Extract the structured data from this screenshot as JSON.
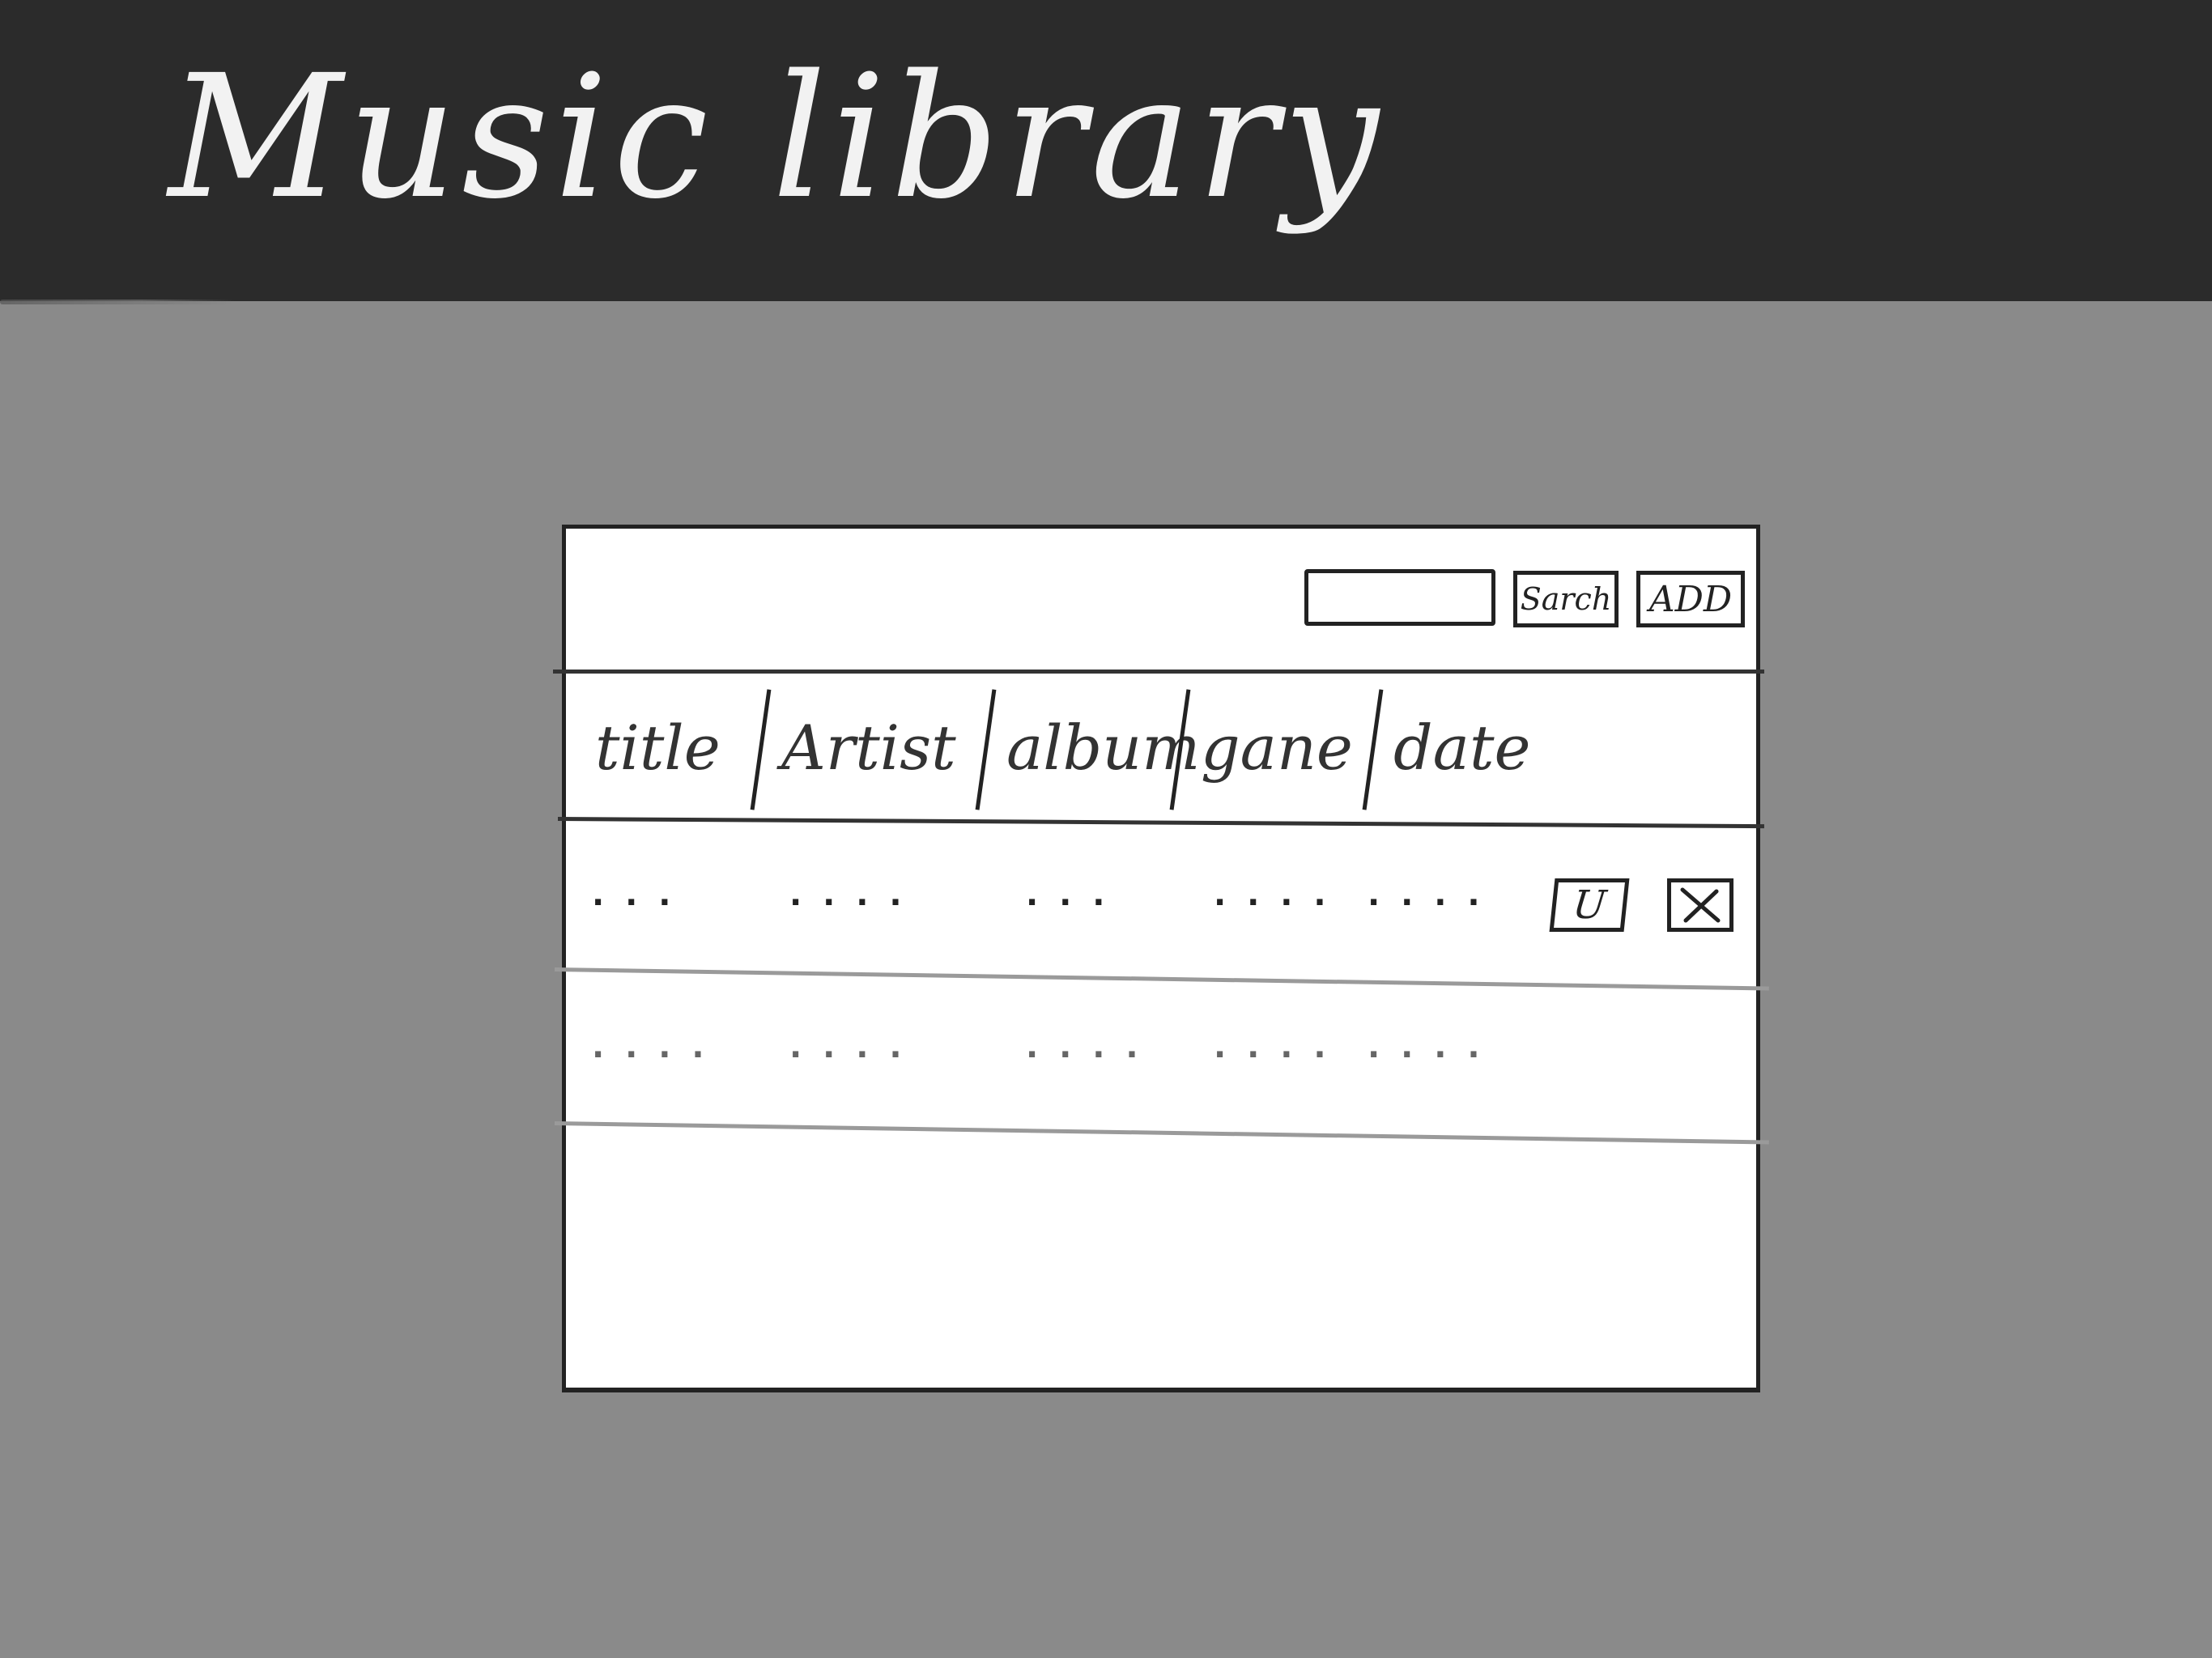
{
  "header": {
    "title": "Music library"
  },
  "toolbar": {
    "search_placeholder": "",
    "search_label": "Sarch",
    "add_label": "ADD"
  },
  "table": {
    "columns": [
      "title",
      "Artist",
      "album",
      "gane",
      "date"
    ],
    "rows": [
      {
        "cells": [
          "· · ·",
          "· · · ·",
          "· · ·",
          "· · · ·",
          "· · · ·"
        ],
        "update_label": "U",
        "delete_icon": "x-icon"
      },
      {
        "cells": [
          "· · · ·",
          "· · · ·",
          "· · · ·",
          "· · · ·",
          "· · · ·"
        ]
      }
    ]
  },
  "colors": {
    "header_bg": "#2b2b2b",
    "page_bg": "#8a8a8a",
    "panel_bg": "#ffffff",
    "ink": "#222222"
  }
}
